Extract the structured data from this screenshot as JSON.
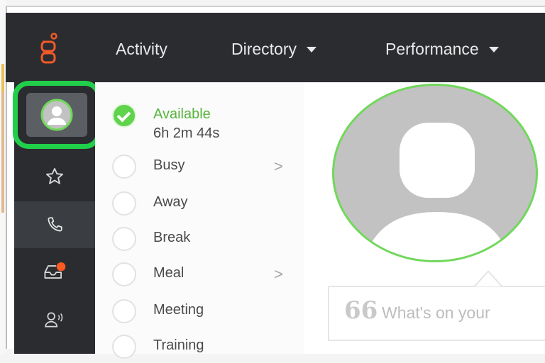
{
  "nav": {
    "activity_label": "Activity",
    "directory_label": "Directory",
    "performance_label": "Performance"
  },
  "sidebar": {
    "items": [
      {
        "name": "profile",
        "icon": "user-avatar-icon"
      },
      {
        "name": "favorites",
        "icon": "star-icon"
      },
      {
        "name": "phone",
        "icon": "phone-icon"
      },
      {
        "name": "inbox",
        "icon": "inbox-icon"
      },
      {
        "name": "speaker",
        "icon": "speaker-person-icon"
      }
    ]
  },
  "status": {
    "items": [
      {
        "label": "Available",
        "duration": "6h 2m 44s",
        "selected": true
      },
      {
        "label": "Busy",
        "has_submenu": true
      },
      {
        "label": "Away"
      },
      {
        "label": "Break"
      },
      {
        "label": "Meal",
        "has_submenu": true
      },
      {
        "label": "Meeting"
      },
      {
        "label": "Training"
      }
    ],
    "chevron": ">"
  },
  "main": {
    "post_placeholder": "What's on your",
    "quote_glyph": "66"
  },
  "colors": {
    "accent_green": "#5fd34b",
    "highlight_green": "#21d04a",
    "topbar": "#2b2c30",
    "logo_orange": "#f05a28",
    "notification_orange": "#ff5a1f"
  }
}
